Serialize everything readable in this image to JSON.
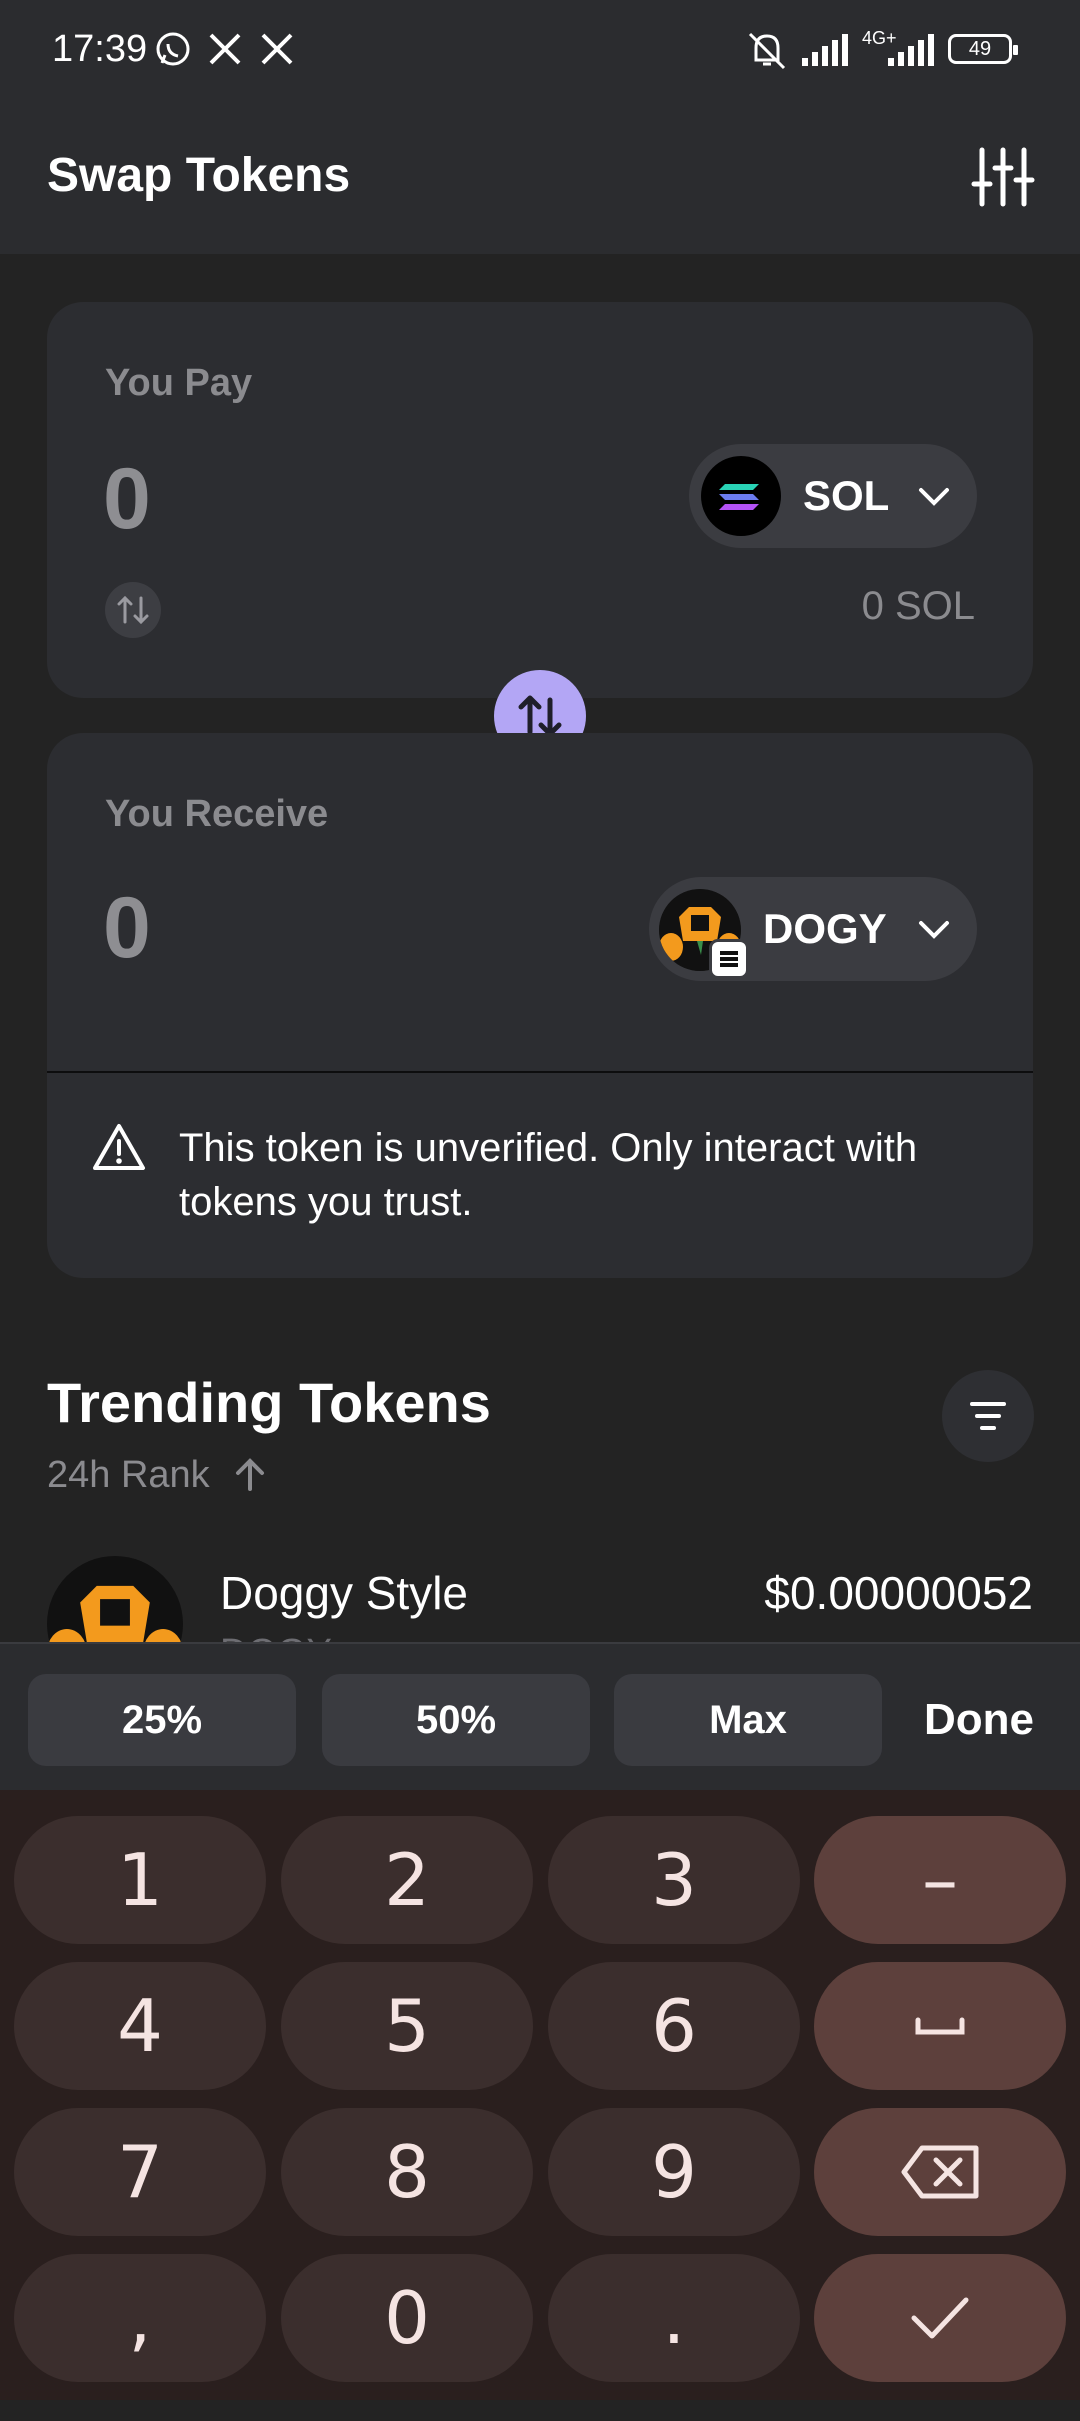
{
  "status_bar": {
    "time": "17:39",
    "network": "4G+",
    "battery": "49"
  },
  "header": {
    "title": "Swap Tokens"
  },
  "pay": {
    "label": "You Pay",
    "amount": "0",
    "token": "SOL",
    "balance": "0 SOL"
  },
  "receive": {
    "label": "You Receive",
    "amount": "0",
    "token": "DOGY",
    "warning": "This token is unverified. Only interact with tokens you trust."
  },
  "trending": {
    "title": "Trending Tokens",
    "sort_label": "24h Rank",
    "rows": [
      {
        "name": "Doggy Style",
        "symbol": "DOGY",
        "price": "$0.00000052"
      }
    ]
  },
  "quick_amounts": {
    "p25": "25%",
    "p50": "50%",
    "max": "Max",
    "done": "Done"
  },
  "keyboard": {
    "rows": [
      [
        "1",
        "2",
        "3",
        "–"
      ],
      [
        "4",
        "5",
        "6",
        "␣"
      ],
      [
        "7",
        "8",
        "9",
        "⌫"
      ],
      [
        ",",
        "0",
        ".",
        "✓"
      ]
    ]
  },
  "colors": {
    "accent": "#b3a6f5",
    "positive": "#3fb68b",
    "background": "#232323",
    "panel": "#2c2d31"
  }
}
